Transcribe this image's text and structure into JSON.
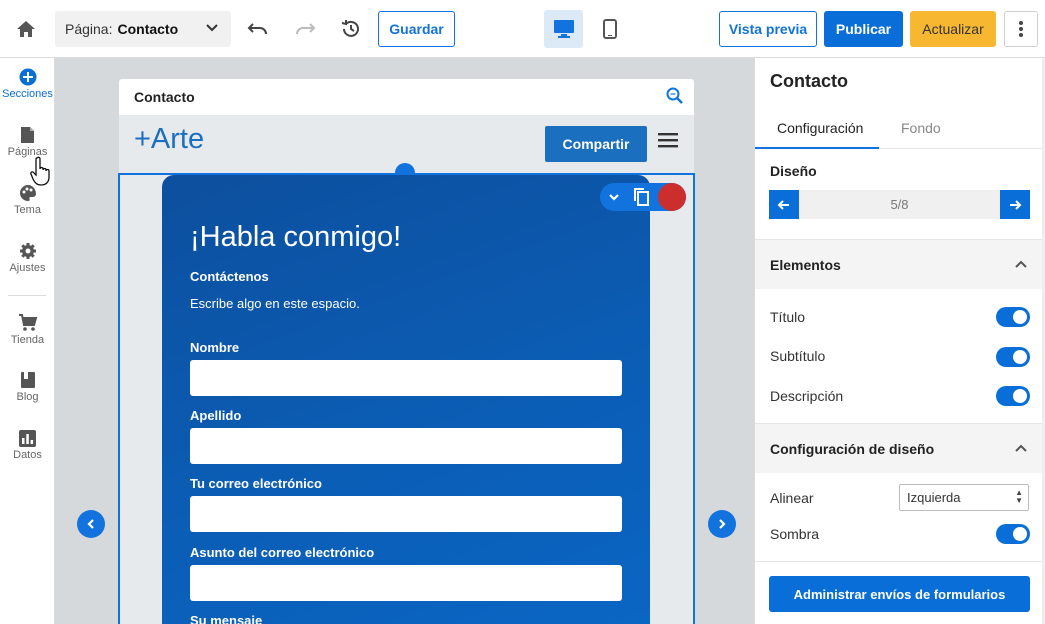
{
  "topbar": {
    "page_label": "Página:",
    "page_value": "Contacto",
    "save_label": "Guardar",
    "preview_label": "Vista previa",
    "publish_label": "Publicar",
    "update_label": "Actualizar"
  },
  "sidebar": {
    "items": [
      {
        "label": "Secciones",
        "icon": "plus-circle-icon"
      },
      {
        "label": "Páginas",
        "icon": "page-icon"
      },
      {
        "label": "Tema",
        "icon": "palette-icon"
      },
      {
        "label": "Ajustes",
        "icon": "gear-icon"
      },
      {
        "label": "Tienda",
        "icon": "cart-icon"
      },
      {
        "label": "Blog",
        "icon": "book-icon"
      },
      {
        "label": "Datos",
        "icon": "chart-icon"
      }
    ]
  },
  "site": {
    "page_name": "Contacto",
    "logo": "+Arte",
    "share_label": "Compartir"
  },
  "form": {
    "title": "¡Habla conmigo!",
    "subtitle": "Contáctenos",
    "description": "Escribe algo en este espacio.",
    "fields": [
      {
        "label": "Nombre"
      },
      {
        "label": "Apellido"
      },
      {
        "label": "Tu correo electrónico"
      },
      {
        "label": "Asunto del correo electrónico"
      },
      {
        "label": "Su mensaje"
      }
    ]
  },
  "panel": {
    "title": "Contacto",
    "tabs": [
      "Configuración",
      "Fondo"
    ],
    "design_label": "Diseño",
    "design_value": "5/8",
    "elements_heading": "Elementos",
    "elements": [
      {
        "label": "Título",
        "on": true
      },
      {
        "label": "Subtítulo",
        "on": true
      },
      {
        "label": "Descripción",
        "on": true
      }
    ],
    "design_settings_heading": "Configuración de diseño",
    "align_label": "Alinear",
    "align_value": "Izquierda",
    "shadow_label": "Sombra",
    "admin_button": "Administrar envíos de formularios"
  },
  "colors": {
    "accent": "#0a6ed8",
    "warn": "#f7b731",
    "form_bg": "#0b5cb3",
    "delete": "#cc2d2d"
  }
}
